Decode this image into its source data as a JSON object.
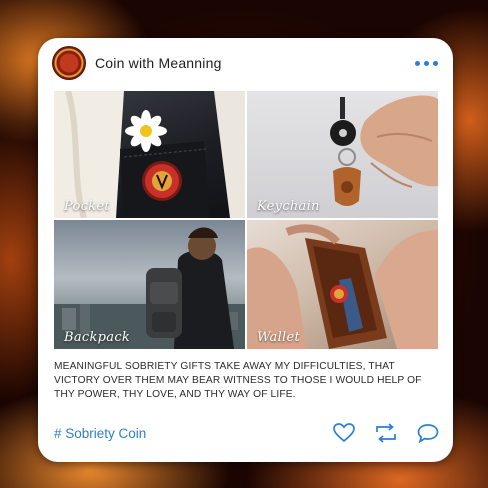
{
  "post": {
    "account_name": "Coin with Meanning",
    "caption": "MEANINGFUL SOBRIETY GIFTS TAKE AWAY MY DIFFICULTIES, THAT VICTORY OVER THEM MAY BEAR WITNESS TO THOSE I WOULD HELP OF THY POWER, THY LOVE, AND THY WAY OF LIFE.",
    "hashtag": "# Sobriety Coin",
    "photos": [
      {
        "label": "Pocket"
      },
      {
        "label": "Keychain"
      },
      {
        "label": "Backpack"
      },
      {
        "label": "Wallet"
      }
    ]
  },
  "icons": {
    "menu": "more-dots-icon",
    "like": "heart-icon",
    "share": "repost-icon",
    "comment": "comment-icon"
  },
  "colors": {
    "accent": "#2a7fd4",
    "card": "#ffffff",
    "text": "#2b2b2b"
  }
}
